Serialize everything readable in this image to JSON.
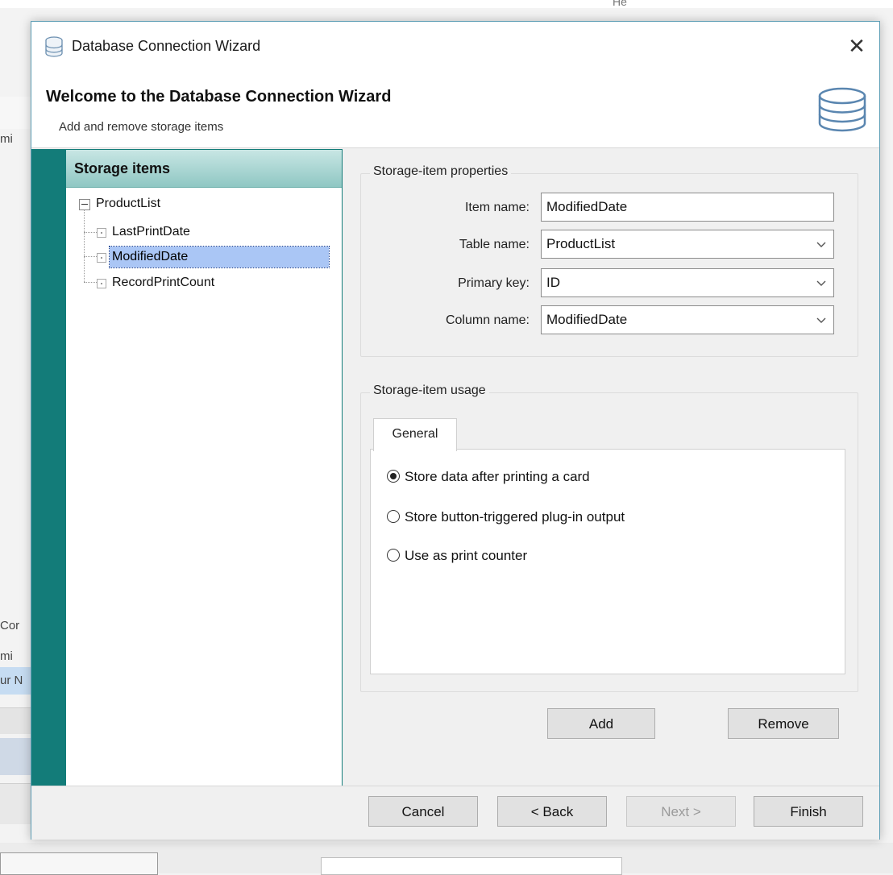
{
  "background": {
    "top_text": "Не",
    "side_fragments": [
      "mi",
      "Cor",
      "mi",
      "ur N"
    ]
  },
  "dialog": {
    "title": "Database Connection Wizard",
    "close_symbol": "✕",
    "header": {
      "title": "Welcome to the Database Connection Wizard",
      "subtitle": "Add and remove storage items"
    }
  },
  "tree": {
    "header": "Storage items",
    "root": "ProductList",
    "children": [
      "LastPrintDate",
      "ModifiedDate",
      "RecordPrintCount"
    ],
    "selected": "ModifiedDate"
  },
  "properties": {
    "group_title": "Storage-item properties",
    "item_name_label": "Item name:",
    "item_name_value": "ModifiedDate",
    "table_name_label": "Table name:",
    "table_name_value": "ProductList",
    "primary_key_label": "Primary key:",
    "primary_key_value": "ID",
    "column_name_label": "Column name:",
    "column_name_value": "ModifiedDate"
  },
  "usage": {
    "group_title": "Storage-item usage",
    "tab_label": "General",
    "options": [
      {
        "label": "Store data after printing a card",
        "checked": true
      },
      {
        "label": "Store button-triggered plug-in output",
        "checked": false
      },
      {
        "label": "Use as print counter",
        "checked": false
      }
    ]
  },
  "buttons": {
    "add": "Add",
    "remove": "Remove",
    "cancel": "Cancel",
    "back": "< Back",
    "next": "Next >",
    "finish": "Finish"
  },
  "colors": {
    "accent": "#137c79",
    "selection": "#aac6f5",
    "dialog_border": "#5e9eb5"
  }
}
